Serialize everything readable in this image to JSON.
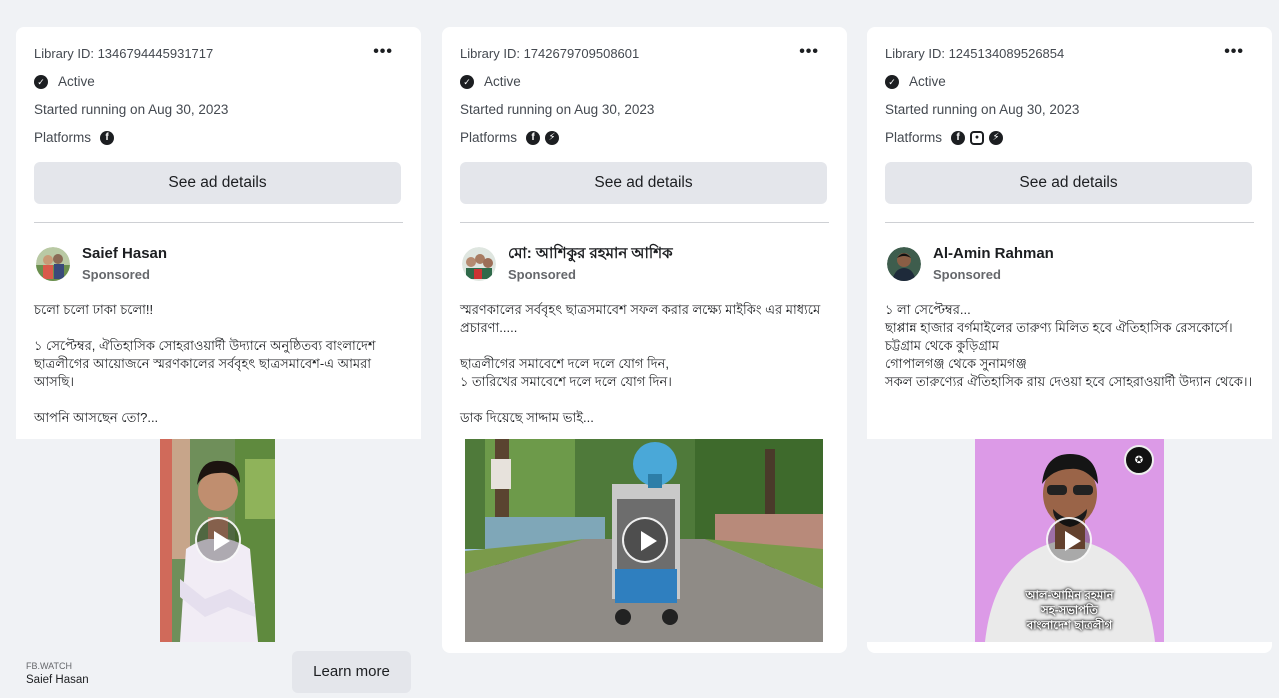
{
  "cards": [
    {
      "library_id": "Library ID: 1346794445931717",
      "status": "Active",
      "started": "Started running on Aug 30, 2023",
      "platforms_label": "Platforms",
      "platforms": [
        "facebook-icon"
      ],
      "see_details": "See ad details",
      "more": "•••",
      "author": "Saief Hasan",
      "sponsored": "Sponsored",
      "body": "চলো চলো ঢাকা চলো!!\n\n১ সেপ্টেম্বর, ঐতিহাসিক সোহরাওয়ার্দী উদ্যানে অনুষ্ঠিতব্য বাংলাদেশ ছাত্রলীগের আয়োজনে স্মরণকালের সর্ববৃহৎ ছাত্রসমাবেশ-এ আমরা আসছি।\n\nআপনি আসছেন তো?...",
      "footer_domain": "FB.WATCH",
      "footer_name": "Saief Hasan",
      "learn_more": "Learn more"
    },
    {
      "library_id": "Library ID: 1742679709508601",
      "status": "Active",
      "started": "Started running on Aug 30, 2023",
      "platforms_label": "Platforms",
      "platforms": [
        "facebook-icon",
        "messenger-icon"
      ],
      "see_details": "See ad details",
      "more": "•••",
      "author": "মো: আশিকুর রহমান আশিক",
      "sponsored": "Sponsored",
      "body": "স্মরণকালের সর্ববৃহৎ ছাত্রসমাবেশ সফল করার লক্ষ্যে মাইকিং এর মাধ্যমে প্রচারণা.....\n\nছাত্রলীগের সমাবেশে দলে দলে যোগ দিন,\n১ তারিখের সমাবেশে দলে দলে যোগ দিন।\n\nডাক দিয়েছে সাদ্দাম ভাই..."
    },
    {
      "library_id": "Library ID: 1245134089526854",
      "status": "Active",
      "started": "Started running on Aug 30, 2023",
      "platforms_label": "Platforms",
      "platforms": [
        "facebook-icon",
        "instagram-icon",
        "messenger-icon"
      ],
      "see_details": "See ad details",
      "more": "•••",
      "author": "Al-Amin Rahman",
      "sponsored": "Sponsored",
      "body": "১ লা সেপ্টেম্বর...\nছাপ্পান্ন হাজার বর্গমাইলের তারুণ্য মিলিত হবে ঐতিহাসিক রেসকোর্সে।\nচট্টগ্রাম থেকে কুড়িগ্রাম\nগোপালগঞ্জ থেকে সুনামগঞ্জ\nসকল তারুণ্যের ঐতিহাসিক রায় দেওয়া হবে সোহরাওয়ার্দী উদ্যান থেকে।।",
      "video_caption": "আল-আমিন রহমান\nসহ-সভাপতি\nবাংলাদেশ ছাত্রলীগ"
    }
  ],
  "colors": {
    "page_bg": "#f0f2f5",
    "card_bg": "#ffffff",
    "button_bg": "#e4e6eb",
    "text_primary": "#1c1e21",
    "text_secondary": "#65676b"
  }
}
